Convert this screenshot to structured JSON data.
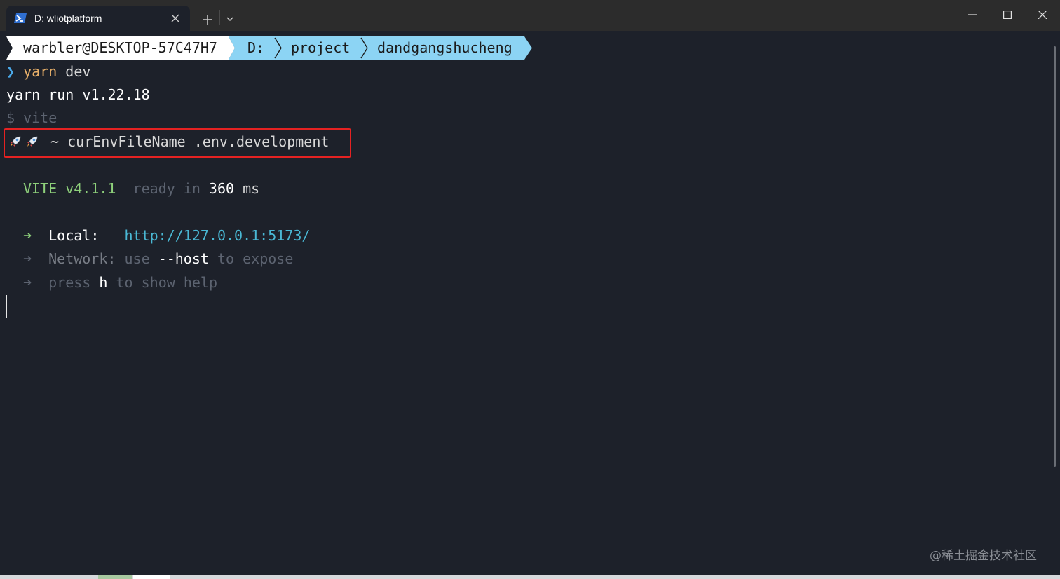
{
  "window": {
    "tab_title": "D: wliotplatform"
  },
  "prompt": {
    "user_host": "warbler@DESKTOP-57C47H7",
    "path_segments": [
      "D:",
      "project",
      "dandgangshucheng"
    ],
    "chevron": "❯",
    "command_name": "yarn",
    "command_args": " dev"
  },
  "output": {
    "yarn_version_line": "yarn run v1.22.18",
    "vite_cmd_line": "$ vite",
    "env_line_text": " ~ curEnvFileName .env.development",
    "vite_label": "VITE v4.1.1",
    "ready_text": "ready in",
    "ready_ms": "360",
    "ready_unit": "ms",
    "arrow": "➜",
    "local_label": "Local:",
    "local_url": "http://127.0.0.1:5173/",
    "network_label": "Network:",
    "network_use": "use",
    "network_flag": "--host",
    "network_suffix": "to expose",
    "press_text": "press",
    "press_key": "h",
    "press_suffix": "to show help"
  },
  "watermark": "@稀土掘金技术社区",
  "colors": {
    "background": "#1d212a",
    "prompt_user_bg": "#ffffff",
    "prompt_path_bg": "#8cd4f4",
    "highlight_border": "#e52222",
    "link": "#4ab8d4",
    "vite_green": "#8ed07b"
  }
}
